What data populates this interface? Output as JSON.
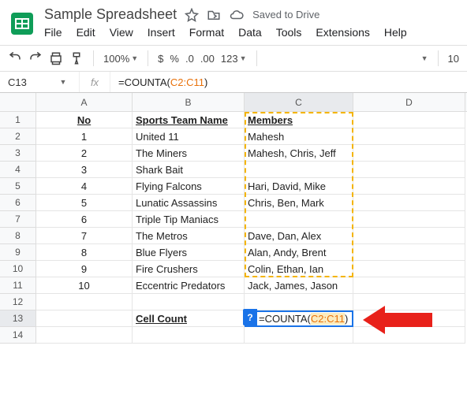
{
  "doc": {
    "title": "Sample Spreadsheet",
    "status": "Saved to Drive"
  },
  "menu": {
    "file": "File",
    "edit": "Edit",
    "view": "View",
    "insert": "Insert",
    "format": "Format",
    "data": "Data",
    "tools": "Tools",
    "extensions": "Extensions",
    "help": "Help"
  },
  "toolbar": {
    "zoom": "100%",
    "dollar": "$",
    "percent": "%",
    "dec0": ".0",
    "dec00": ".00",
    "numfmt": "123",
    "fontsize": "10"
  },
  "fx": {
    "cellref": "C13",
    "pre": "=COUNTA(",
    "range": "C2:C11",
    "post": ")"
  },
  "cols": {
    "a": "A",
    "b": "B",
    "c": "C",
    "d": "D"
  },
  "head": {
    "no": "No",
    "team": "Sports Team Name",
    "members": "Members"
  },
  "rows": [
    {
      "n": "1",
      "team": "United 11",
      "m": "Mahesh"
    },
    {
      "n": "2",
      "team": "The Miners",
      "m": "Mahesh, Chris, Jeff"
    },
    {
      "n": "3",
      "team": "Shark Bait",
      "m": ""
    },
    {
      "n": "4",
      "team": "Flying Falcons",
      "m": "Hari, David, Mike"
    },
    {
      "n": "5",
      "team": "Lunatic Assassins",
      "m": "Chris, Ben, Mark"
    },
    {
      "n": "6",
      "team": "Triple Tip Maniacs",
      "m": ""
    },
    {
      "n": "7",
      "team": "The Metros",
      "m": "Dave, Dan, Alex"
    },
    {
      "n": "8",
      "team": "Blue Flyers",
      "m": "Alan, Andy, Brent"
    },
    {
      "n": "9",
      "team": "Fire Crushers",
      "m": "Colin, Ethan, Ian"
    },
    {
      "n": "10",
      "team": "Eccentric Predators",
      "m": "Jack, James, Jason"
    }
  ],
  "label": {
    "cellcount": "Cell Count"
  },
  "hint": {
    "q": "?"
  },
  "rownums": {
    "r1": "1",
    "r2": "2",
    "r3": "3",
    "r4": "4",
    "r5": "5",
    "r6": "6",
    "r7": "7",
    "r8": "8",
    "r9": "9",
    "r10": "10",
    "r11": "11",
    "r12": "12",
    "r13": "13",
    "r14": "14"
  }
}
